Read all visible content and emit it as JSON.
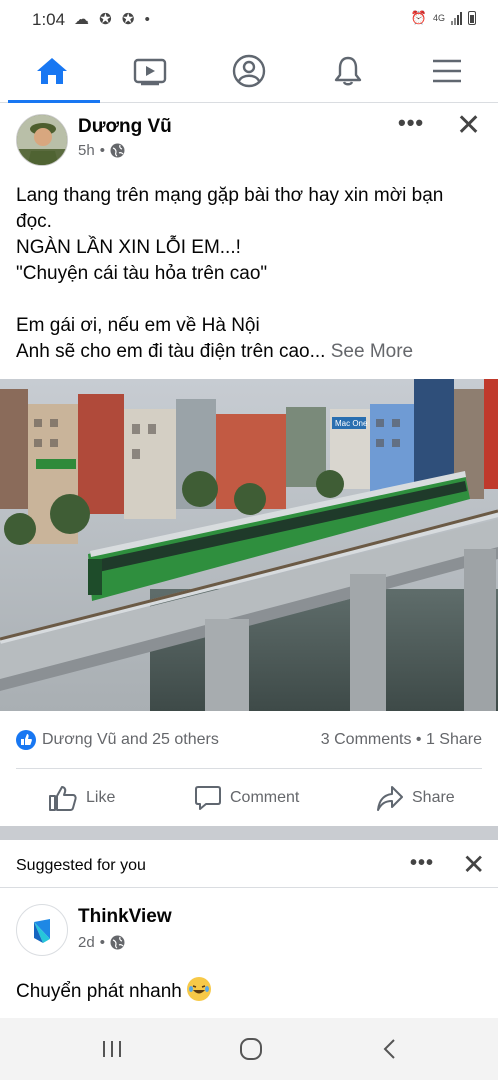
{
  "status_bar": {
    "time": "1:04",
    "network": "4G"
  },
  "nav": {
    "tabs": [
      "home-icon",
      "video-icon",
      "profile-icon",
      "notifications-icon",
      "menu-icon"
    ],
    "active": 0,
    "accent": "#1877f2"
  },
  "post": {
    "author": "Dương Vũ",
    "time": "5h",
    "privacy_icon": "globe-icon",
    "text_lines": [
      "Lang thang trên mạng gặp bài thơ hay xin mời bạn",
      "đọc.",
      "NGÀN LẦN XIN LỖI EM...!",
      "\"Chuyện cái tàu hỏa trên cao\"",
      "",
      "Em gái ơi, nếu em về Hà Nội"
    ],
    "last_line": "Anh sẽ cho em đi tàu điện trên cao...",
    "see_more": "See More",
    "photo_signs": [
      "Mac One"
    ],
    "reactions_text": "Dương Vũ and 25 others",
    "counts_text": "3 Comments • 1 Share",
    "actions": {
      "like": "Like",
      "comment": "Comment",
      "share": "Share"
    }
  },
  "suggested": {
    "title": "Suggested for you",
    "page_name": "ThinkView",
    "time": "2d",
    "text": "Chuyển phát nhanh"
  }
}
